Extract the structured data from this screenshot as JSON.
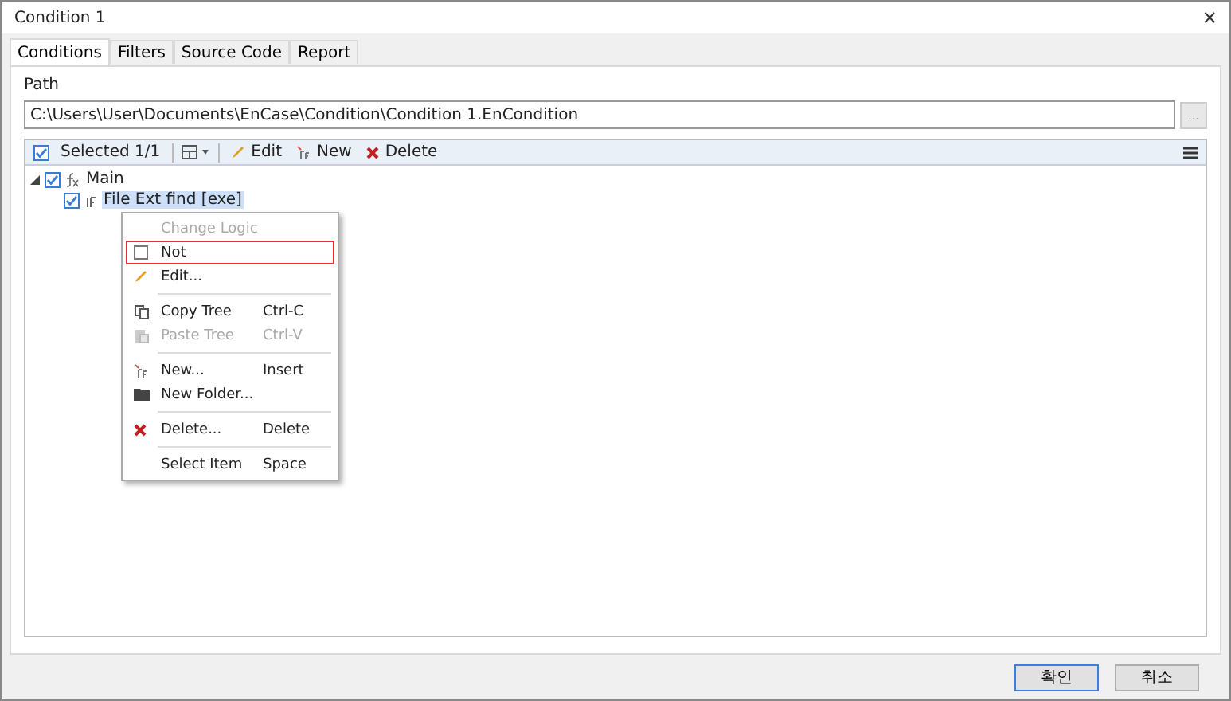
{
  "window": {
    "title": "Condition 1",
    "close": "×"
  },
  "tabs": [
    {
      "label": "Conditions",
      "selected": true
    },
    {
      "label": "Filters",
      "selected": false
    },
    {
      "label": "Source Code",
      "selected": false
    },
    {
      "label": "Report",
      "selected": false
    }
  ],
  "path": {
    "label": "Path",
    "value": "C:\\Users\\User\\Documents\\EnCase\\Condition\\Condition 1.EnCondition",
    "browse": "..."
  },
  "toolbar": {
    "selected_label": "Selected 1/1",
    "selected_checked": true,
    "buttons": [
      {
        "label": "Edit"
      },
      {
        "label": "New"
      },
      {
        "label": "Delete"
      }
    ]
  },
  "tree": [
    {
      "label": "Main",
      "checked": true,
      "expanded": true,
      "selected": false,
      "children": [
        {
          "label": "File Ext find [exe]",
          "checked": true,
          "selected": true
        }
      ]
    }
  ],
  "context_menu": [
    {
      "kind": "header",
      "label": "Change Logic",
      "disabled": true
    },
    {
      "kind": "check",
      "label": "Not",
      "checked": false,
      "selected": true
    },
    {
      "kind": "item",
      "label": "Edit...",
      "disabled": false
    },
    {
      "kind": "separator"
    },
    {
      "kind": "item",
      "label": "Copy Tree",
      "shortcut": "Ctrl-C",
      "disabled": false
    },
    {
      "kind": "item",
      "label": "Paste Tree",
      "shortcut": "Ctrl-V",
      "disabled": true
    },
    {
      "kind": "separator"
    },
    {
      "kind": "item",
      "label": "New...",
      "shortcut": "Insert",
      "disabled": false
    },
    {
      "kind": "item",
      "label": "New Folder...",
      "disabled": false
    },
    {
      "kind": "separator"
    },
    {
      "kind": "item",
      "label": "Delete...",
      "shortcut": "Delete",
      "disabled": false
    },
    {
      "kind": "separator"
    },
    {
      "kind": "item",
      "label": "Select Item",
      "shortcut": "Space",
      "disabled": false
    }
  ],
  "buttons": [
    {
      "label": "확인",
      "default": true
    },
    {
      "label": "취소",
      "default": false
    }
  ]
}
